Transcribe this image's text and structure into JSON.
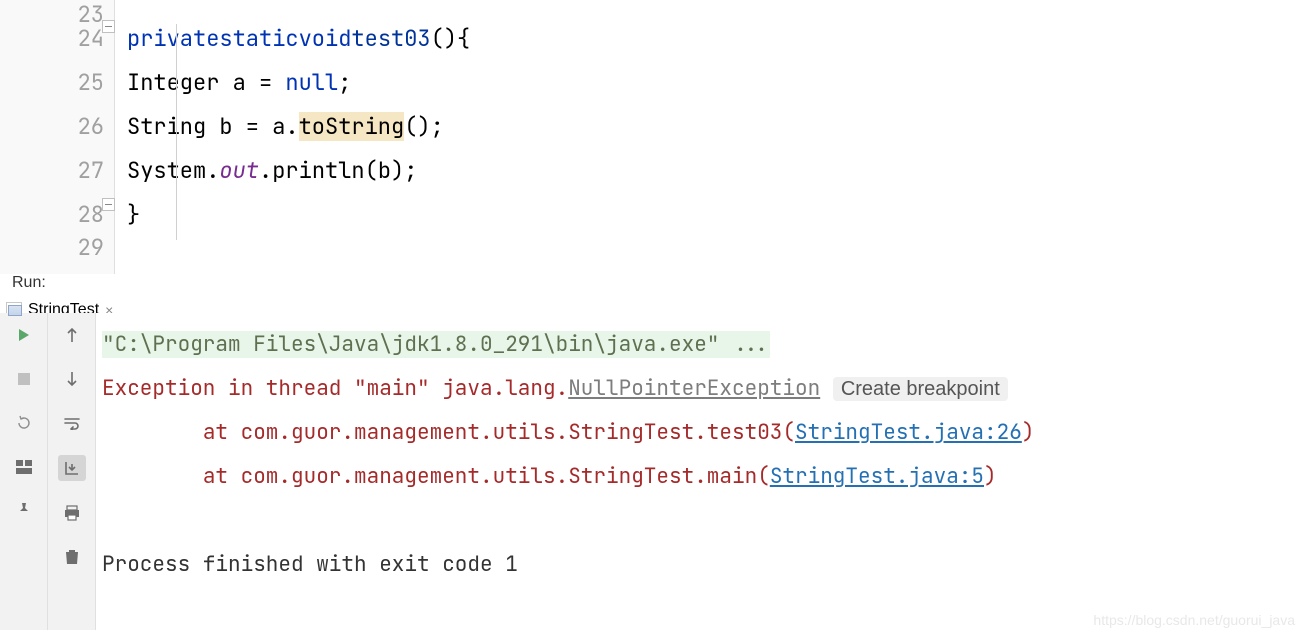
{
  "editor": {
    "lines": {
      "23": "23",
      "24": "24",
      "25": "25",
      "26": "26",
      "27": "27",
      "28": "28",
      "29": "29"
    },
    "code": {
      "l24_kw1": "private",
      "l24_kw2": "static",
      "l24_kw3": "void",
      "l24_name": "test03",
      "l24_tail": "(){",
      "l25_type": "Integer a = ",
      "l25_null": "null",
      "l25_semi": ";",
      "l26_pre": "String b = a.",
      "l26_hl": "toString",
      "l26_post": "();",
      "l27_sys": "System.",
      "l27_out": "out",
      "l27_println": ".println(b);",
      "l28_brace": "}"
    }
  },
  "run": {
    "label": "Run:",
    "tabName": "StringTest",
    "output": {
      "cmd": "\"C:\\Program Files\\Java\\jdk1.8.0_291\\bin\\java.exe\" ...",
      "exceptionPrefix": "Exception in thread \"main\" java.lang.",
      "exceptionName": "NullPointerException",
      "createBreakpoint": "Create breakpoint",
      "at1_pre": "\tat com.guor.management.utils.StringTest.test03(",
      "at1_link": "StringTest.java:26",
      "at1_post": ")",
      "at2_pre": "\tat com.guor.management.utils.StringTest.main(",
      "at2_link": "StringTest.java:5",
      "at2_post": ")",
      "finished": "Process finished with exit code 1"
    }
  },
  "watermark": "https://blog.csdn.net/guorui_java"
}
